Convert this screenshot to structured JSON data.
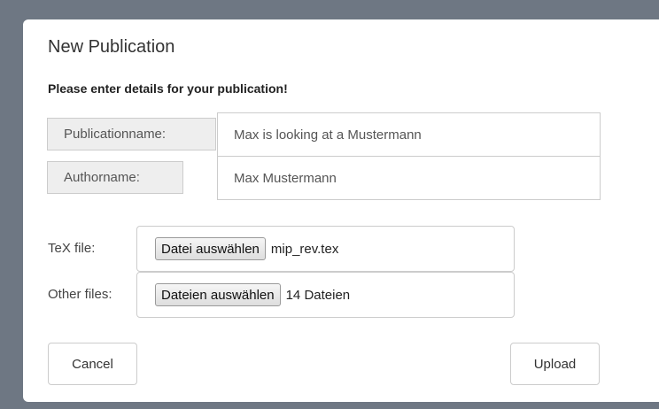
{
  "dialog": {
    "title": "New Publication",
    "subtitle": "Please enter details for your publication!"
  },
  "fields": {
    "publication_name": {
      "label": "Publicationname:",
      "value": "Max is looking at a Mustermann"
    },
    "author_name": {
      "label": "Authorname:",
      "value": "Max Mustermann"
    }
  },
  "files": {
    "tex": {
      "label": "TeX file:",
      "button": "Datei auswählen",
      "selection": "mip_rev.tex"
    },
    "other": {
      "label": "Other files:",
      "button": "Dateien auswählen",
      "selection": "14 Dateien"
    }
  },
  "actions": {
    "cancel": "Cancel",
    "upload": "Upload"
  },
  "colors": {
    "backdrop": "#6e7783",
    "dialog_background": "#ffffff",
    "addon_background": "#eeeeee",
    "border": "#cccccc"
  }
}
